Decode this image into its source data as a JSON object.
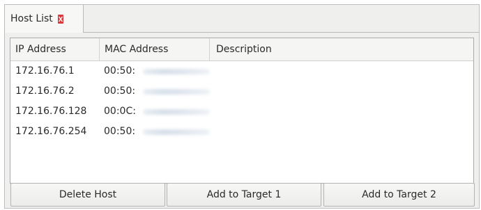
{
  "tab": {
    "title": "Host List",
    "close_icon": "close-icon",
    "close_color": "#d9383c"
  },
  "table": {
    "columns": [
      "IP Address",
      "MAC Address",
      "Description"
    ],
    "rows": [
      {
        "ip": "172.16.76.1",
        "mac": "00:50:",
        "description": ""
      },
      {
        "ip": "172.16.76.2",
        "mac": "00:50:",
        "description": ""
      },
      {
        "ip": "172.16.76.128",
        "mac": "00:0C:",
        "description": ""
      },
      {
        "ip": "172.16.76.254",
        "mac": "00:50:",
        "description": ""
      }
    ]
  },
  "buttons": {
    "delete": "Delete Host",
    "target1": "Add to Target 1",
    "target2": "Add to Target 2"
  }
}
